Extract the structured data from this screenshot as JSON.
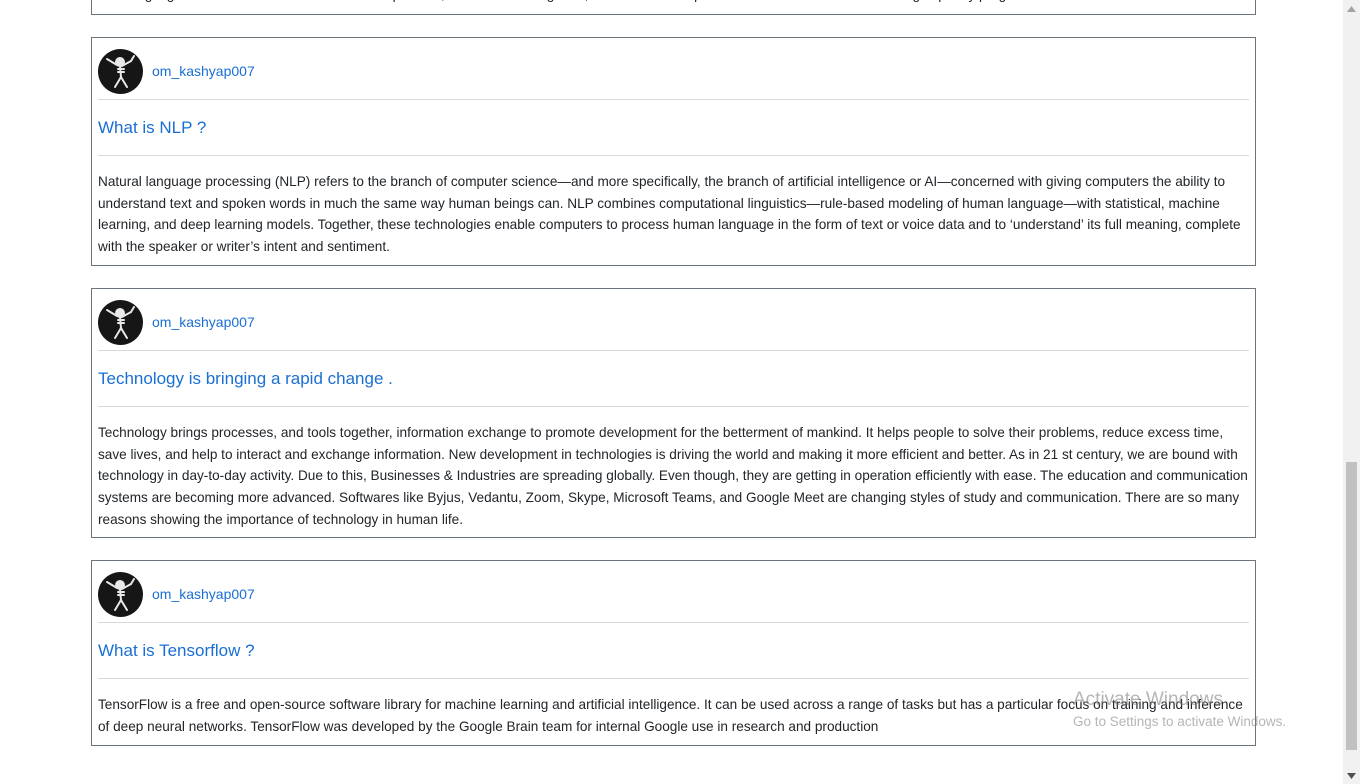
{
  "posts": [
    {
      "body": "learning algorithms build a model based on sample data, known as training data, in order to make predictions or decisions without being explicitly programmed to do so"
    },
    {
      "author": "om_kashyap007",
      "title": "What is NLP ?",
      "body": "Natural language processing (NLP) refers to the branch of computer science—and more specifically, the branch of artificial intelligence or AI—concerned with giving computers the ability to understand text and spoken words in much the same way human beings can. NLP combines computational linguistics—rule-based modeling of human language—with statistical, machine learning, and deep learning models. Together, these technologies enable computers to process human language in the form of text or voice data and to ‘understand’ its full meaning, complete with the speaker or writer’s intent and sentiment."
    },
    {
      "author": "om_kashyap007",
      "title": "Technology is bringing a rapid change .",
      "body": "Technology brings processes, and tools together, information exchange to promote development for the betterment of mankind. It helps people to solve their problems, reduce excess time, save lives, and help to interact and exchange information. New development in technologies is driving the world and making it more efficient and better. As in 21 st century, we are bound with technology in day-to-day activity. Due to this, Businesses & Industries are spreading globally. Even though, they are getting in operation efficiently with ease. The education and communication systems are becoming more advanced. Softwares like Byjus, Vedantu, Zoom, Skype, Microsoft Teams, and Google Meet are changing styles of study and communication. There are so many reasons showing the importance of technology in human life."
    },
    {
      "author": "om_kashyap007",
      "title": "What is Tensorflow ?",
      "body": "TensorFlow is a free and open-source software library for machine learning and artificial intelligence. It can be used across a range of tasks but has a particular focus on training and inference of deep neural networks. TensorFlow was developed by the Google Brain team for internal Google use in research and production"
    }
  ],
  "watermark": {
    "line1": "Activate Windows",
    "line2": "Go to Settings to activate Windows."
  },
  "icons": {
    "avatar": "skeleton-dab-avatar-icon",
    "scroll_up": "scroll-up-arrow-icon",
    "scroll_down": "scroll-down-arrow-icon"
  },
  "colors": {
    "link": "#1a6fd4",
    "avatar_bg": "#161616",
    "card_border": "#6c757d"
  }
}
